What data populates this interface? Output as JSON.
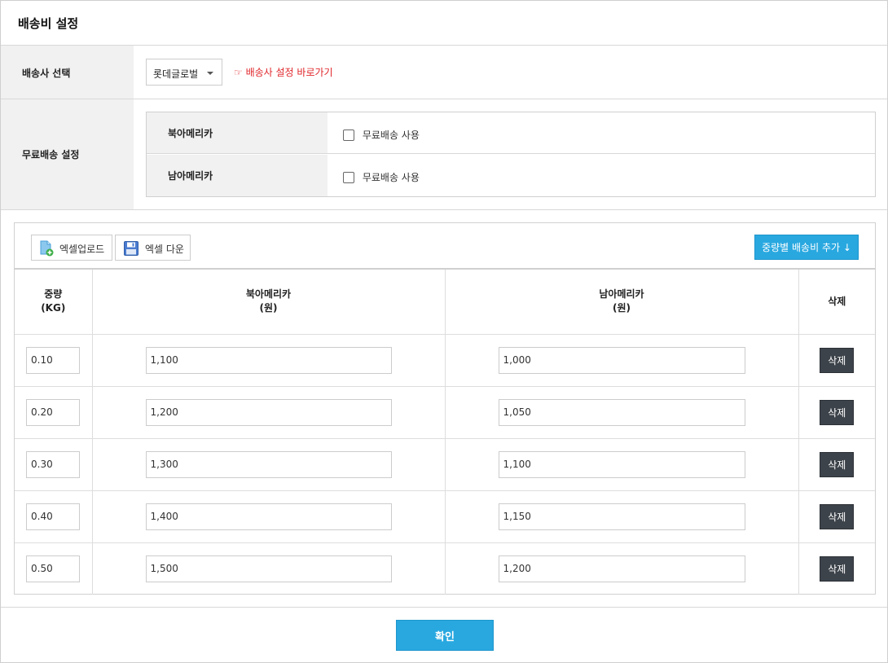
{
  "header": {
    "title": "배송비 설정"
  },
  "carrier": {
    "label": "배송사 선택",
    "selected": "롯데글로벌",
    "link_text": "☞ 배송사 설정 바로가기"
  },
  "free_shipping": {
    "label": "무료배송 설정",
    "regions": [
      {
        "name": "북아메리카",
        "checkbox_label": "무료배송 사용",
        "checked": false
      },
      {
        "name": "남아메리카",
        "checkbox_label": "무료배송 사용",
        "checked": false
      }
    ]
  },
  "toolbar": {
    "upload_label": "엑셀업로드",
    "download_label": "엑셀 다운",
    "add_label": "중량별 배송비 추가 ↓"
  },
  "table": {
    "headers": {
      "weight": "중량",
      "weight_unit": "(KG)",
      "north": "북아메리카",
      "north_unit": "(원)",
      "south": "남아메리카",
      "south_unit": "(원)",
      "delete": "삭제"
    },
    "rows": [
      {
        "weight": "0.10",
        "north": "1,100",
        "south": "1,000",
        "delete_label": "삭제"
      },
      {
        "weight": "0.20",
        "north": "1,200",
        "south": "1,050",
        "delete_label": "삭제"
      },
      {
        "weight": "0.30",
        "north": "1,300",
        "south": "1,100",
        "delete_label": "삭제"
      },
      {
        "weight": "0.40",
        "north": "1,400",
        "south": "1,150",
        "delete_label": "삭제"
      },
      {
        "weight": "0.50",
        "north": "1,500",
        "south": "1,200",
        "delete_label": "삭제"
      }
    ]
  },
  "footer": {
    "confirm_label": "확인"
  },
  "colors": {
    "accent": "#29a8e0",
    "link": "#e0262a",
    "delete_button": "#3d434a"
  },
  "icons": {
    "upload": "excel-upload-icon",
    "download": "floppy-disk-icon"
  }
}
